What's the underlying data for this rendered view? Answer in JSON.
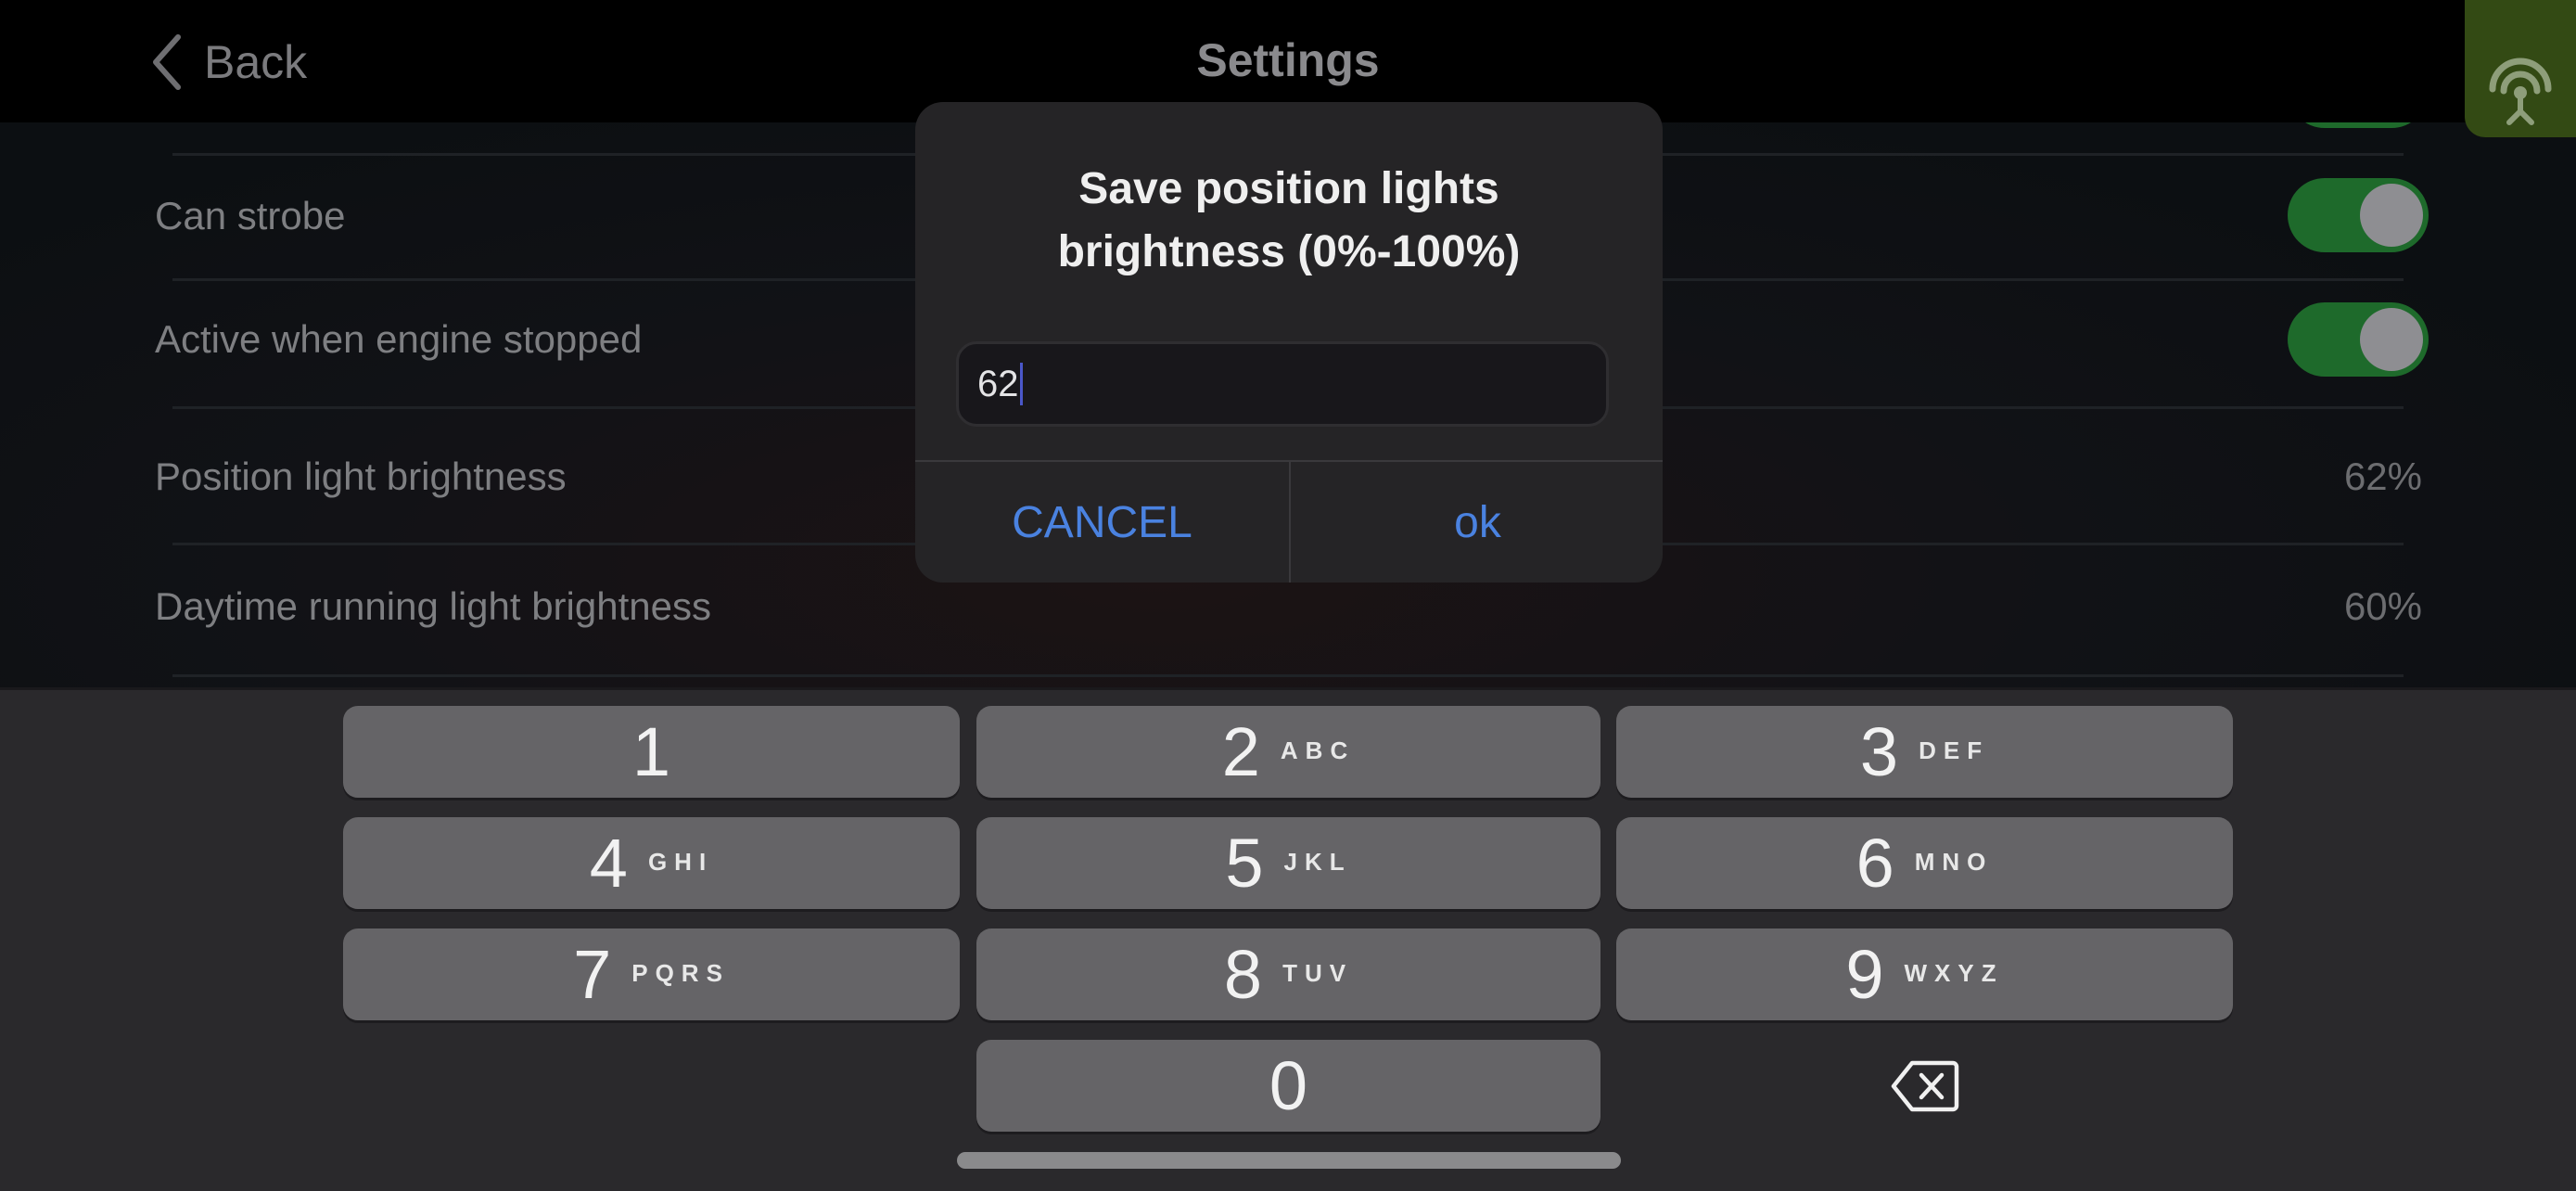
{
  "navbar": {
    "back_label": "Back",
    "title": "Settings",
    "connection_icon": "antenna-signal-icon",
    "connection_badge_color": "#334a14"
  },
  "settings": {
    "rows": [
      {
        "label": "Can strobe",
        "type": "toggle",
        "on": true
      },
      {
        "label": "Active when engine stopped",
        "type": "toggle",
        "on": true
      },
      {
        "label": "Position light brightness",
        "type": "value",
        "value": "62%"
      },
      {
        "label": "Daytime running light brightness",
        "type": "value",
        "value": "60%"
      }
    ],
    "toggle_on_color": "#1e6a2b"
  },
  "dialog": {
    "title_line1": "Save position lights",
    "title_line2": "brightness (0%-100%)",
    "input_value": "62",
    "cancel_label": "CANCEL",
    "ok_label": "ok",
    "button_color": "#4a82e0"
  },
  "keyboard": {
    "keys": [
      {
        "digit": "1",
        "letters": ""
      },
      {
        "digit": "2",
        "letters": "ABC"
      },
      {
        "digit": "3",
        "letters": "DEF"
      },
      {
        "digit": "4",
        "letters": "GHI"
      },
      {
        "digit": "5",
        "letters": "JKL"
      },
      {
        "digit": "6",
        "letters": "MNO"
      },
      {
        "digit": "7",
        "letters": "PQRS"
      },
      {
        "digit": "8",
        "letters": "TUV"
      },
      {
        "digit": "9",
        "letters": "WXYZ"
      },
      {
        "digit": "0",
        "letters": ""
      }
    ],
    "delete_icon": "backspace-icon"
  }
}
